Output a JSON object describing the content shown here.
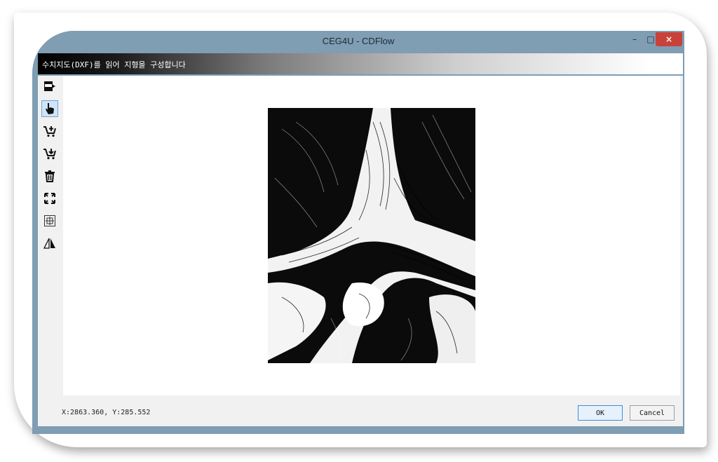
{
  "window": {
    "title": "CEG4U - CDFlow",
    "min_label": "–",
    "max_label": "□",
    "close_label": "×"
  },
  "banner": {
    "text": "수치지도(DXF)를 읽어 지형을 구성합니다"
  },
  "toolbar": {
    "items": [
      {
        "name": "dxf-open-icon",
        "glyph": "▣",
        "active": false
      },
      {
        "name": "hand-pan-icon",
        "glyph": "☚",
        "active": true
      },
      {
        "name": "cart-add-icon",
        "glyph": "⛟",
        "active": false
      },
      {
        "name": "cart-remove-icon",
        "glyph": "⛟",
        "active": false
      },
      {
        "name": "trash-icon",
        "glyph": "🗑",
        "active": false
      },
      {
        "name": "zoom-extent-icon",
        "glyph": "⤡",
        "active": false
      },
      {
        "name": "grid-icon",
        "glyph": "⊞",
        "active": false
      },
      {
        "name": "mirror-icon",
        "glyph": "◭",
        "active": false
      }
    ]
  },
  "status": {
    "coordinates": "X:2863.360, Y:285.552",
    "ok_label": "OK",
    "cancel_label": "Cancel"
  },
  "colors": {
    "title_bar": "#7f9db3",
    "close_button": "#c9423a",
    "active_tool": "#cfe4f7"
  }
}
